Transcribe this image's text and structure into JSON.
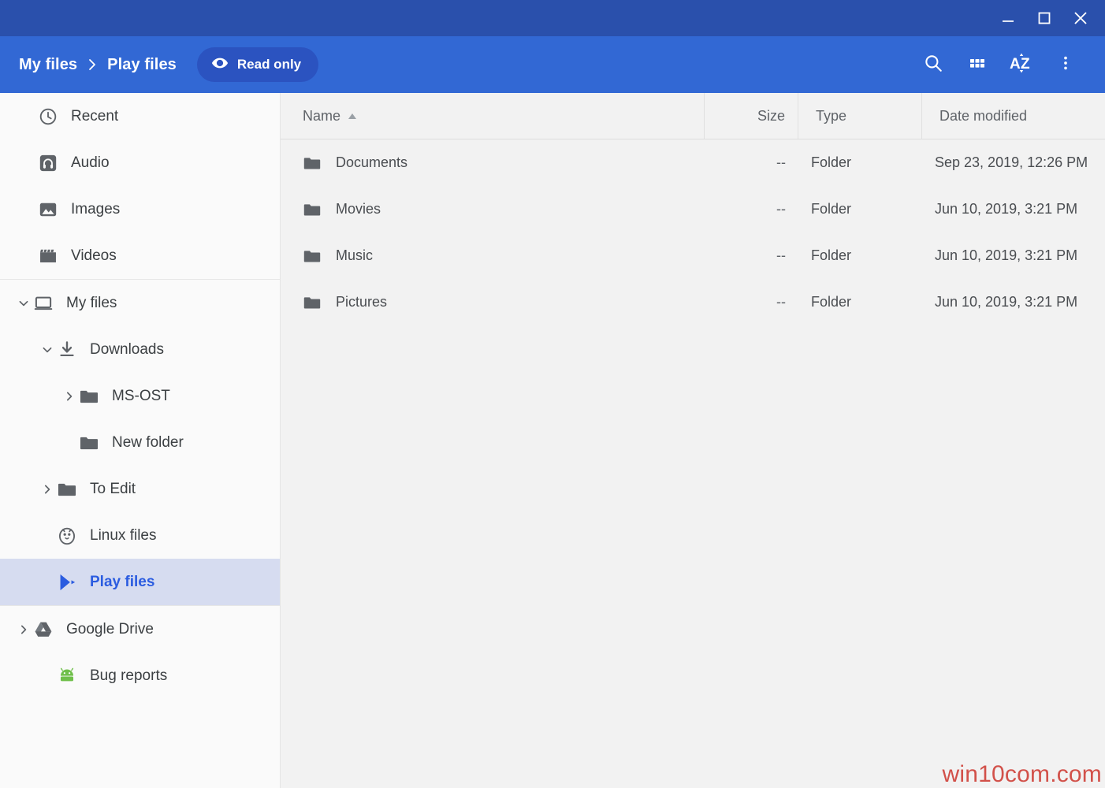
{
  "window": {
    "titlebar_color": "#2a50ac",
    "toolbar_color": "#3268d4",
    "controls": [
      {
        "name": "minimize",
        "icon": "minimize-icon"
      },
      {
        "name": "maximize",
        "icon": "maximize-icon"
      },
      {
        "name": "close",
        "icon": "close-icon"
      }
    ]
  },
  "toolbar": {
    "breadcrumb": [
      {
        "label": "My files"
      },
      {
        "label": "Play files"
      }
    ],
    "separator": "›",
    "readonly_badge": {
      "label": "Read only",
      "icon": "eye-icon",
      "color": "#2b53c0"
    },
    "actions": [
      {
        "name": "search",
        "icon": "search-icon"
      },
      {
        "name": "view-grid",
        "icon": "grid-view-icon"
      },
      {
        "name": "sort",
        "icon": "sort-az-icon",
        "label": "AZ"
      },
      {
        "name": "more",
        "icon": "more-vertical-icon"
      }
    ]
  },
  "sidebar": {
    "selected_color": "#d6dcf0",
    "selected_text_color": "#2b5ce0",
    "groups": [
      {
        "items": [
          {
            "label": "Recent",
            "icon": "clock-icon",
            "level": 0,
            "chevron": "none",
            "selected": false
          },
          {
            "label": "Audio",
            "icon": "audio-icon",
            "level": 0,
            "chevron": "none",
            "selected": false
          },
          {
            "label": "Images",
            "icon": "image-icon",
            "level": 0,
            "chevron": "none",
            "selected": false
          },
          {
            "label": "Videos",
            "icon": "video-icon",
            "level": 0,
            "chevron": "none",
            "selected": false
          }
        ]
      },
      {
        "items": [
          {
            "label": "My files",
            "icon": "laptop-icon",
            "level": "root",
            "chevron": "down",
            "selected": false
          },
          {
            "label": "Downloads",
            "icon": "download-icon",
            "level": 1,
            "chevron": "down",
            "selected": false
          },
          {
            "label": "MS-OST",
            "icon": "folder-icon",
            "level": 2,
            "chevron": "right",
            "selected": false
          },
          {
            "label": "New folder",
            "icon": "folder-icon",
            "level": 2,
            "chevron": "none",
            "selected": false
          },
          {
            "label": "To Edit",
            "icon": "folder-icon",
            "level": 1,
            "chevron": "right",
            "selected": false
          },
          {
            "label": "Linux files",
            "icon": "linux-penguin-icon",
            "level": 1,
            "chevron": "none",
            "selected": false
          },
          {
            "label": "Play files",
            "icon": "google-play-icon",
            "level": 1,
            "chevron": "none",
            "selected": true
          }
        ]
      },
      {
        "items": [
          {
            "label": "Google Drive",
            "icon": "google-drive-icon",
            "level": "root",
            "chevron": "right",
            "selected": false
          },
          {
            "label": "Bug reports",
            "icon": "android-icon",
            "level": 1,
            "chevron": "none",
            "selected": false
          }
        ]
      }
    ]
  },
  "file_list": {
    "columns": [
      {
        "key": "name",
        "label": "Name",
        "sorted": true,
        "sort_direction": "asc"
      },
      {
        "key": "size",
        "label": "Size",
        "sorted": false
      },
      {
        "key": "type",
        "label": "Type",
        "sorted": false
      },
      {
        "key": "date",
        "label": "Date modified",
        "sorted": false
      }
    ],
    "rows": [
      {
        "icon": "folder-icon",
        "name": "Documents",
        "size": "--",
        "type": "Folder",
        "date": "Sep 23, 2019, 12:26 PM"
      },
      {
        "icon": "folder-icon",
        "name": "Movies",
        "size": "--",
        "type": "Folder",
        "date": "Jun 10, 2019, 3:21 PM"
      },
      {
        "icon": "folder-icon",
        "name": "Music",
        "size": "--",
        "type": "Folder",
        "date": "Jun 10, 2019, 3:21 PM"
      },
      {
        "icon": "folder-icon",
        "name": "Pictures",
        "size": "--",
        "type": "Folder",
        "date": "Jun 10, 2019, 3:21 PM"
      }
    ]
  },
  "watermark": {
    "text": "win10com.com",
    "color": "#d2514a"
  }
}
